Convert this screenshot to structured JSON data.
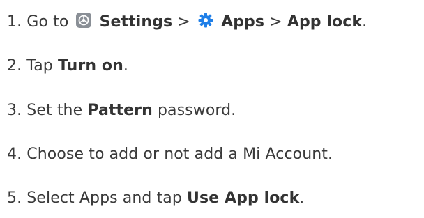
{
  "steps": [
    {
      "number": "1.",
      "text_1": "Go to",
      "bold_1": "Settings",
      "sep_1": ">",
      "bold_2": "Apps",
      "sep_2": ">",
      "bold_3": "App lock",
      "end": ".",
      "icons": [
        "settings-icon",
        "apps-gear-icon"
      ]
    },
    {
      "number": "2.",
      "text_1": "Tap",
      "bold_1": "Turn on",
      "end": "."
    },
    {
      "number": "3.",
      "text_1": "Set the",
      "bold_1": "Pattern",
      "text_2": "password."
    },
    {
      "number": "4.",
      "text_1": "Choose to add or not add a Mi Account."
    },
    {
      "number": "5.",
      "text_1": "Select Apps and tap",
      "bold_1": "Use App lock",
      "end": "."
    }
  ],
  "colors": {
    "text": "#3a3a3a",
    "settings_icon_bg": "#8a8f96",
    "apps_icon": "#1f7fe8"
  }
}
